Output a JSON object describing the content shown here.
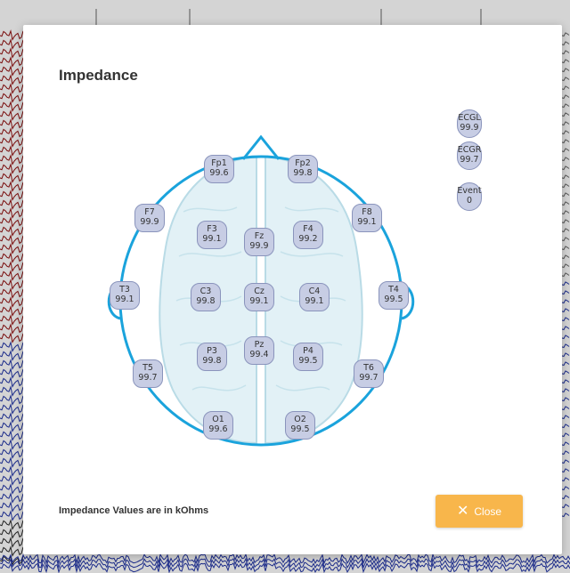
{
  "dialog": {
    "title": "Impedance",
    "footer_note": "Impedance Values are in kOhms",
    "close_label": "Close",
    "close_icon": "close-icon"
  },
  "electrodes": [
    {
      "id": "fp1",
      "label": "Fp1",
      "value": "99.6"
    },
    {
      "id": "fp2",
      "label": "Fp2",
      "value": "99.8"
    },
    {
      "id": "f7",
      "label": "F7",
      "value": "99.9"
    },
    {
      "id": "f8",
      "label": "F8",
      "value": "99.1"
    },
    {
      "id": "f3",
      "label": "F3",
      "value": "99.1"
    },
    {
      "id": "fz",
      "label": "Fz",
      "value": "99.9"
    },
    {
      "id": "f4",
      "label": "F4",
      "value": "99.2"
    },
    {
      "id": "t3",
      "label": "T3",
      "value": "99.1"
    },
    {
      "id": "c3",
      "label": "C3",
      "value": "99.8"
    },
    {
      "id": "cz",
      "label": "Cz",
      "value": "99.1"
    },
    {
      "id": "c4",
      "label": "C4",
      "value": "99.1"
    },
    {
      "id": "t4",
      "label": "T4",
      "value": "99.5"
    },
    {
      "id": "p3",
      "label": "P3",
      "value": "99.8"
    },
    {
      "id": "pz",
      "label": "Pz",
      "value": "99.4"
    },
    {
      "id": "p4",
      "label": "P4",
      "value": "99.5"
    },
    {
      "id": "t5",
      "label": "T5",
      "value": "99.7"
    },
    {
      "id": "t6",
      "label": "T6",
      "value": "99.7"
    },
    {
      "id": "o1",
      "label": "O1",
      "value": "99.6"
    },
    {
      "id": "o2",
      "label": "O2",
      "value": "99.5"
    }
  ],
  "aux_channels": [
    {
      "id": "ecgl",
      "label": "ECGL",
      "value": "99.9"
    },
    {
      "id": "ecgr",
      "label": "ECGR",
      "value": "99.7"
    },
    {
      "id": "event",
      "label": "Event",
      "value": "0"
    }
  ],
  "colors": {
    "head_outline": "#1aa3dc",
    "electrode_fill": "#c7cde4",
    "close_button": "#f8b64b"
  }
}
